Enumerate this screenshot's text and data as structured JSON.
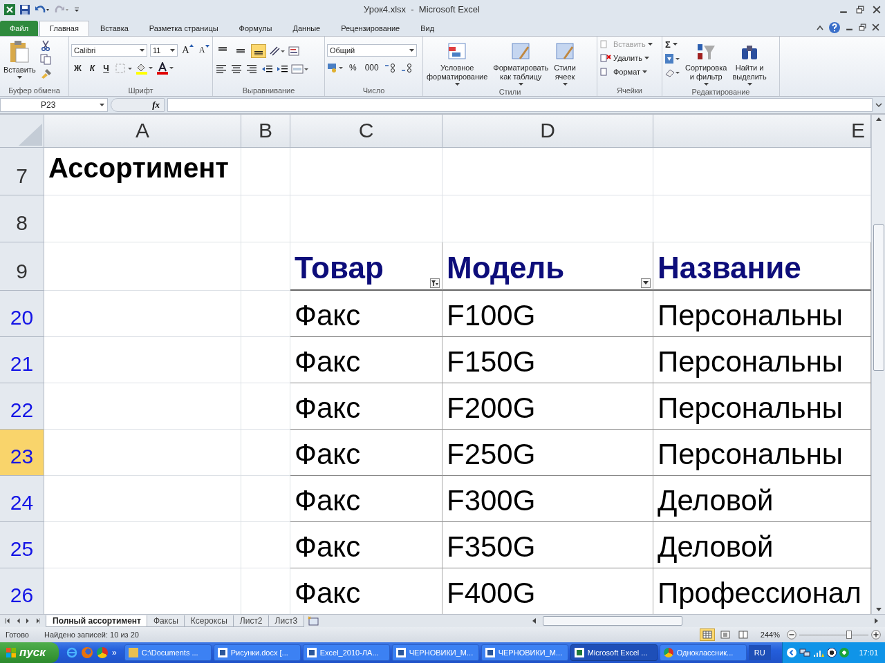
{
  "window": {
    "title": "Урок4.xlsx  -  Microsoft Excel"
  },
  "ribbon_tabs": [
    {
      "label": "Файл",
      "kind": "file",
      "selected": false
    },
    {
      "label": "Главная",
      "kind": "tab",
      "selected": true
    },
    {
      "label": "Вставка",
      "kind": "tab",
      "selected": false
    },
    {
      "label": "Разметка страницы",
      "kind": "tab",
      "selected": false
    },
    {
      "label": "Формулы",
      "kind": "tab",
      "selected": false
    },
    {
      "label": "Данные",
      "kind": "tab",
      "selected": false
    },
    {
      "label": "Рецензирование",
      "kind": "tab",
      "selected": false
    },
    {
      "label": "Вид",
      "kind": "tab",
      "selected": false
    }
  ],
  "clipboard": {
    "paste": "Вставить",
    "label": "Буфер обмена"
  },
  "font": {
    "name": "Calibri",
    "size": "11",
    "grow": "A",
    "shrink": "A",
    "bold": "Ж",
    "italic": "К",
    "underline": "Ч",
    "label": "Шрифт"
  },
  "alignment": {
    "vertical": [
      {
        "selected": false
      },
      {
        "selected": false
      },
      {
        "selected": true
      }
    ],
    "label": "Выравнивание"
  },
  "number": {
    "format": "Общий",
    "percent": "%",
    "thousands": "000",
    "label": "Число"
  },
  "styles": {
    "items": [
      {
        "label": "Условное\nформатирование"
      },
      {
        "label": "Форматировать\nкак таблицу"
      },
      {
        "label": "Стили\nячеек"
      }
    ],
    "label": "Стили"
  },
  "cells_group": {
    "items": [
      {
        "label": "Вставить",
        "disabled": true
      },
      {
        "label": "Удалить",
        "disabled": false
      },
      {
        "label": "Формат",
        "disabled": false
      }
    ],
    "label": "Ячейки"
  },
  "editing": {
    "sigma": "Σ",
    "items": [
      {
        "label": "Сортировка\nи фильтр"
      },
      {
        "label": "Найти и\nвыделить"
      }
    ],
    "label": "Редактирование"
  },
  "formula_bar": {
    "name_box": "P23",
    "function_label": "fx"
  },
  "columns": [
    "A",
    "B",
    "C",
    "D",
    "E"
  ],
  "rows": [
    {
      "number": "7",
      "kind": "title",
      "selected": false,
      "filtered": false,
      "title": "Ассортимент"
    },
    {
      "number": "8",
      "kind": "blank",
      "selected": false,
      "filtered": false
    },
    {
      "number": "9",
      "kind": "header",
      "selected": false,
      "filtered": false,
      "cells": [
        {
          "text": "Товар",
          "kind": "filtered"
        },
        {
          "text": "Модель",
          "kind": "dropdown"
        },
        {
          "text": "Название",
          "kind": "plain"
        }
      ]
    },
    {
      "number": "20",
      "kind": "data",
      "selected": false,
      "filtered": true,
      "values": [
        "Факс",
        "F100G",
        "Персональны"
      ]
    },
    {
      "number": "21",
      "kind": "data",
      "selected": false,
      "filtered": true,
      "values": [
        "Факс",
        "F150G",
        "Персональны"
      ]
    },
    {
      "number": "22",
      "kind": "data",
      "selected": false,
      "filtered": true,
      "values": [
        "Факс",
        "F200G",
        "Персональны"
      ]
    },
    {
      "number": "23",
      "kind": "data",
      "selected": true,
      "filtered": true,
      "values": [
        "Факс",
        "F250G",
        "Персональны"
      ]
    },
    {
      "number": "24",
      "kind": "data",
      "selected": false,
      "filtered": true,
      "values": [
        "Факс",
        "F300G",
        "Деловой"
      ]
    },
    {
      "number": "25",
      "kind": "data",
      "selected": false,
      "filtered": true,
      "values": [
        "Факс",
        "F350G",
        "Деловой"
      ]
    },
    {
      "number": "26",
      "kind": "data",
      "selected": false,
      "filtered": true,
      "values": [
        "Факс",
        "F400G",
        "Профессионал"
      ]
    }
  ],
  "sheet_tabs": [
    {
      "label": "Полный ассортимент",
      "selected": true
    },
    {
      "label": "Факсы",
      "selected": false
    },
    {
      "label": "Ксероксы",
      "selected": false
    },
    {
      "label": "Лист2",
      "selected": false
    },
    {
      "label": "Лист3",
      "selected": false
    }
  ],
  "status_bar": {
    "ready": "Готово",
    "message": "Найдено записей: 10 из 20",
    "views": [
      {
        "selected": true
      },
      {
        "selected": false
      },
      {
        "selected": false
      }
    ],
    "zoom": "244%",
    "level": 0.72
  },
  "taskbar": {
    "start": "пуск",
    "more": "»",
    "tasks": [
      {
        "label": "C:\\Documents ...",
        "kind": "folder",
        "selected": false
      },
      {
        "label": "Рисунки.docx [...",
        "kind": "word",
        "selected": false
      },
      {
        "label": "Excel_2010-ЛА...",
        "kind": "word",
        "selected": false
      },
      {
        "label": "ЧЕРНОВИКИ_М...",
        "kind": "word",
        "selected": false
      },
      {
        "label": "ЧЕРНОВИКИ_М...",
        "kind": "word",
        "selected": false
      },
      {
        "label": "Microsoft Excel ...",
        "kind": "excel",
        "selected": true
      },
      {
        "label": "Одноклассник...",
        "kind": "chrome",
        "selected": false
      }
    ],
    "language": "RU",
    "time": "17:01"
  }
}
